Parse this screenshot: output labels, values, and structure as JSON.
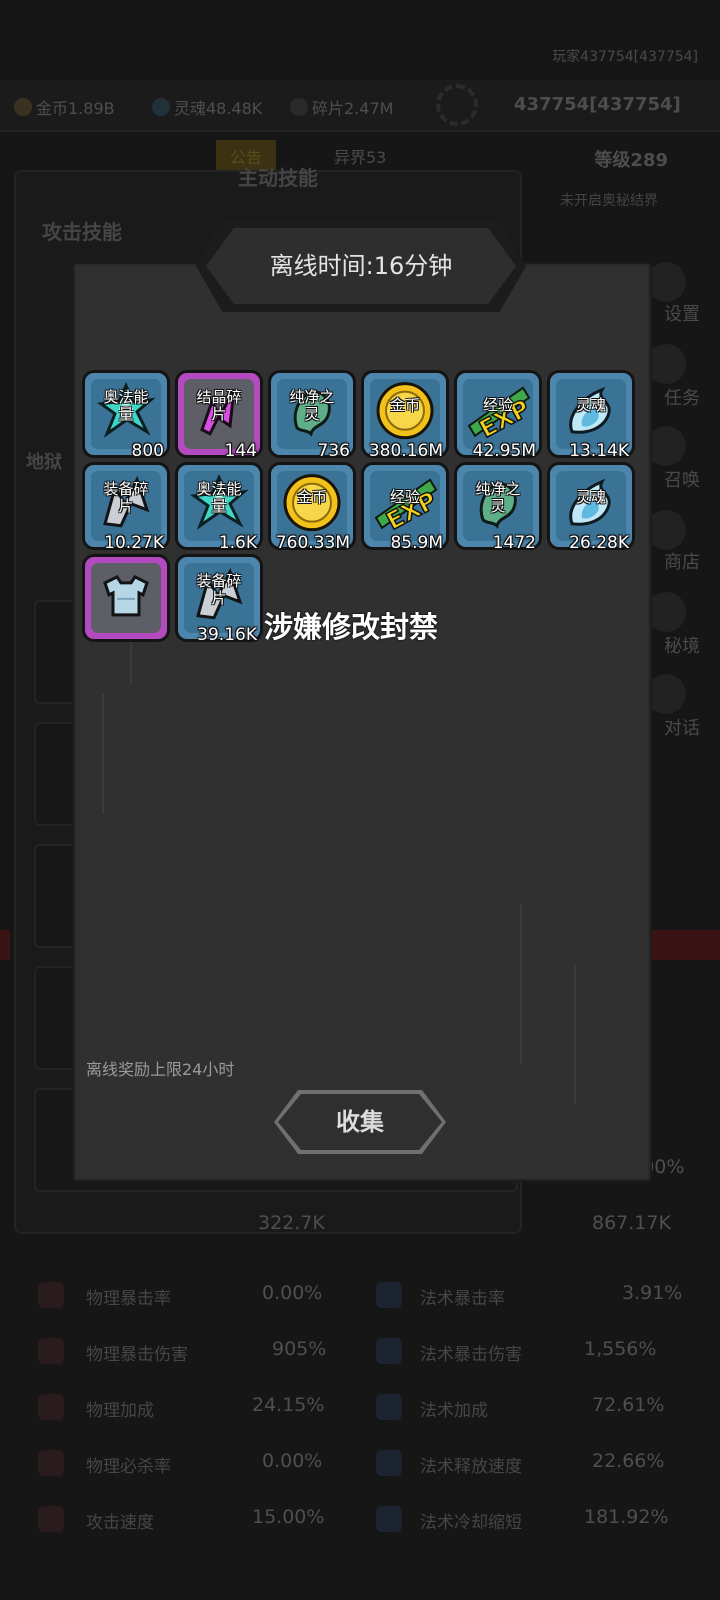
{
  "background": {
    "player_id": "玩家437754[437754]",
    "resources": {
      "gold": "金币1.89B",
      "soul": "灵魂48.48K",
      "shards": "碎片2.47M"
    },
    "power": "437754[437754]",
    "tabs": {
      "notice": "公告",
      "realm": "异界53"
    },
    "level": "等级289",
    "notice_text": "未开启奥秘结界",
    "main_skill": "主动技能",
    "attack_skill": "攻击技能",
    "hell": "地狱",
    "side": [
      "设置",
      "任务",
      "召唤",
      "商店",
      "秘境",
      "对话"
    ],
    "stats": [
      {
        "left_label": "物理暴击率",
        "left_value": "0.00%",
        "right_label": "法术暴击率",
        "right_value": "3.91%"
      },
      {
        "left_label": "物理暴击伤害",
        "left_value": "905%",
        "right_label": "法术暴击伤害",
        "right_value": "1,556%"
      },
      {
        "left_label": "物理加成",
        "left_value": "24.15%",
        "right_label": "法术加成",
        "right_value": "72.61%"
      },
      {
        "left_label": "物理必杀率",
        "left_value": "0.00%",
        "right_label": "法术释放速度",
        "right_value": "22.66%"
      },
      {
        "left_label": "攻击速度",
        "left_value": "15.00%",
        "right_label": "法术冷却缩短",
        "right_value": "181.92%"
      }
    ],
    "stat_partial": {
      "left_value": "322.7K",
      "right_value": "867.17K",
      "top_right": "33.00%"
    }
  },
  "modal": {
    "title": "离线时间:16分钟",
    "items": [
      {
        "label": "奥法能\n量",
        "count": "800",
        "icon": "arcane-crystal-icon",
        "color": "blue"
      },
      {
        "label": "结晶碎\n片",
        "count": "144",
        "icon": "crystal-shard-icon",
        "color": "purple"
      },
      {
        "label": "纯净之\n灵",
        "count": "736",
        "icon": "pure-spirit-icon",
        "color": "blue"
      },
      {
        "label": "金币",
        "count": "380.16M",
        "icon": "gold-coin-icon",
        "color": "blue"
      },
      {
        "label": "经验",
        "count": "42.95M",
        "icon": "exp-icon",
        "color": "blue"
      },
      {
        "label": "灵魂",
        "count": "13.14K",
        "icon": "soul-flame-icon",
        "color": "blue"
      },
      {
        "label": "装备碎\n片",
        "count": "10.27K",
        "icon": "equipment-shard-icon",
        "color": "blue"
      },
      {
        "label": "奥法能\n量",
        "count": "1.6K",
        "icon": "arcane-crystal-icon",
        "color": "blue"
      },
      {
        "label": "金币",
        "count": "760.33M",
        "icon": "gold-coin-icon",
        "color": "blue"
      },
      {
        "label": "经验",
        "count": "85.9M",
        "icon": "exp-icon",
        "color": "blue"
      },
      {
        "label": "纯净之\n灵",
        "count": "1472",
        "icon": "pure-spirit-icon",
        "color": "blue"
      },
      {
        "label": "灵魂",
        "count": "26.28K",
        "icon": "soul-flame-icon",
        "color": "blue"
      },
      {
        "label": "",
        "count": "",
        "icon": "armor-icon",
        "color": "purple"
      },
      {
        "label": "装备碎\n片",
        "count": "39.16K",
        "icon": "equipment-shard-icon",
        "color": "blue"
      }
    ],
    "banned_text": "涉嫌修改封禁",
    "limit_text": "离线奖励上限24小时",
    "collect_label": "收集"
  }
}
